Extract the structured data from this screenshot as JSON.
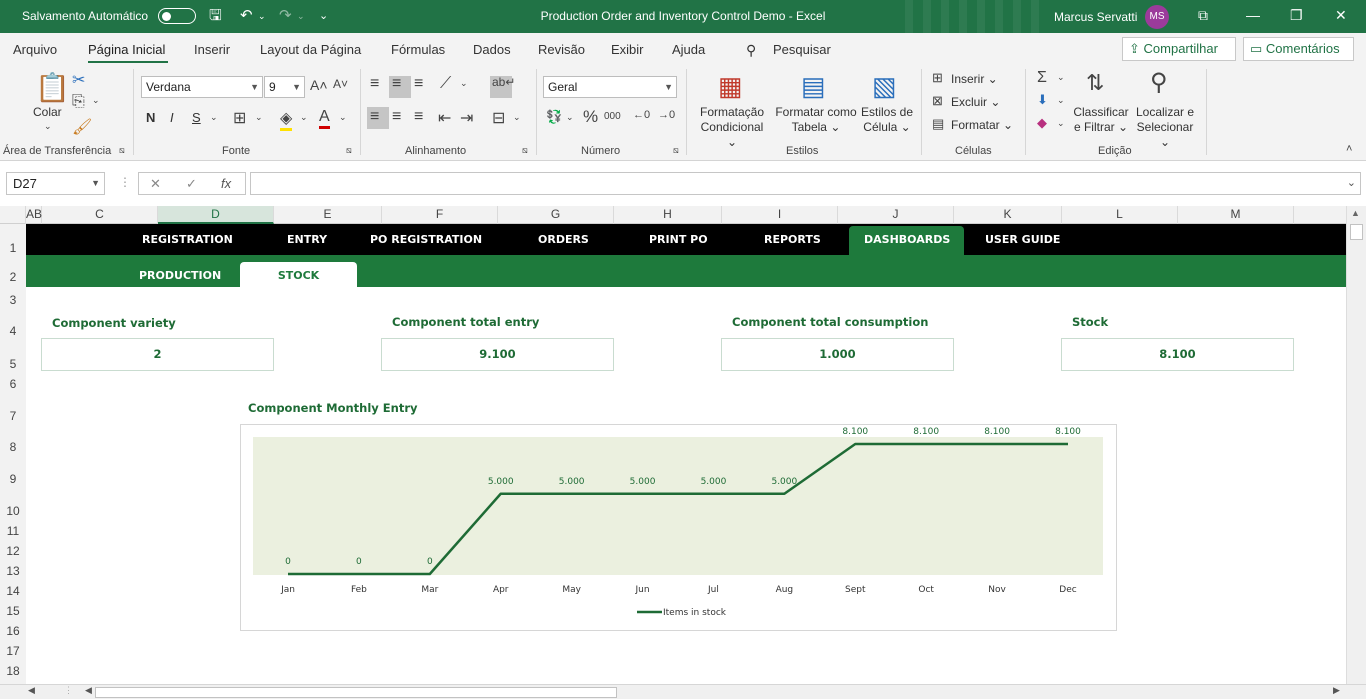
{
  "titlebar": {
    "autosave_label": "Salvamento Automático",
    "title": "Production Order and Inventory Control Demo  -  Excel",
    "user_name": "Marcus Servatti",
    "user_initials": "MS"
  },
  "ribbon_tabs": {
    "items": [
      "Arquivo",
      "Página Inicial",
      "Inserir",
      "Layout da Página",
      "Fórmulas",
      "Dados",
      "Revisão",
      "Exibir",
      "Ajuda"
    ],
    "search_label": "Pesquisar",
    "share_label": "Compartilhar",
    "comments_label": "Comentários"
  },
  "ribbon": {
    "clipboard": {
      "paste_label": "Colar",
      "group_label": "Área de Transferência"
    },
    "font": {
      "family": "Verdana",
      "size": "9",
      "bold": "N",
      "italic": "I",
      "underline": "S",
      "group_label": "Fonte"
    },
    "alignment": {
      "group_label": "Alinhamento"
    },
    "number": {
      "format": "Geral",
      "group_label": "Número"
    },
    "styles": {
      "conditional_line1": "Formatação",
      "conditional_line2": "Condicional",
      "table_line1": "Formatar como",
      "table_line2": "Tabela",
      "cell_line1": "Estilos de",
      "cell_line2": "Célula",
      "group_label": "Estilos"
    },
    "cells": {
      "insert_label": "Inserir",
      "delete_label": "Excluir",
      "format_label": "Formatar",
      "group_label": "Células"
    },
    "editing": {
      "sort_line1": "Classificar",
      "sort_line2": "e Filtrar",
      "find_line1": "Localizar e",
      "find_line2": "Selecionar",
      "group_label": "Edição"
    }
  },
  "formula_bar": {
    "name_box": "D27",
    "formula": ""
  },
  "columns": [
    "AB",
    "C",
    "D",
    "E",
    "F",
    "G",
    "H",
    "I",
    "J",
    "K",
    "L",
    "M"
  ],
  "rows": [
    "1",
    "2",
    "3",
    "4",
    "5",
    "6",
    "7",
    "8",
    "9",
    "10",
    "11",
    "12",
    "13",
    "14",
    "15",
    "16",
    "17",
    "18"
  ],
  "nav": {
    "items": [
      "REGISTRATION",
      "ENTRY",
      "PO REGISTRATION",
      "ORDERS",
      "PRINT PO",
      "REPORTS",
      "DASHBOARDS",
      "USER GUIDE"
    ],
    "active": "DASHBOARDS"
  },
  "subnav": {
    "items": [
      "PRODUCTION",
      "STOCK"
    ],
    "active": "STOCK"
  },
  "kpis": [
    {
      "label": "Component variety",
      "value": "2"
    },
    {
      "label": "Component total entry",
      "value": "9.100"
    },
    {
      "label": "Component total consumption",
      "value": "1.000"
    },
    {
      "label": "Stock",
      "value": "8.100"
    }
  ],
  "chart_data": {
    "type": "line",
    "title": "Component Monthly Entry",
    "categories": [
      "Jan",
      "Feb",
      "Mar",
      "Apr",
      "May",
      "Jun",
      "Jul",
      "Aug",
      "Sept",
      "Oct",
      "Nov",
      "Dec"
    ],
    "series": [
      {
        "name": "Items in stock",
        "values": [
          0,
          0,
          0,
          5000,
          5000,
          5000,
          5000,
          5000,
          8100,
          8100,
          8100,
          8100
        ]
      }
    ],
    "data_labels": [
      "0",
      "0",
      "0",
      "5.000",
      "5.000",
      "5.000",
      "5.000",
      "5.000",
      "8.100",
      "8.100",
      "8.100",
      "8.100"
    ],
    "ylim": [
      0,
      8100
    ],
    "legend": "bottom",
    "plot_background": "#ebf0df",
    "line_color": "#1e6b35"
  }
}
